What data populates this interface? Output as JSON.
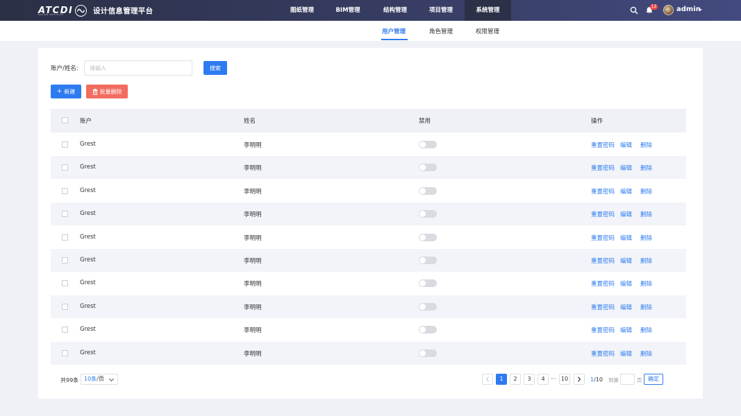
{
  "app": {
    "logo_text": "ATCDI",
    "logo_subtext": "DESIGN INSTITUTE",
    "title": "设计信息管理平台"
  },
  "nav": {
    "items": [
      {
        "label": "图纸管理"
      },
      {
        "label": "BIM管理"
      },
      {
        "label": "结构管理"
      },
      {
        "label": "项目管理"
      },
      {
        "label": "系统管理",
        "active": true
      }
    ],
    "notification_count": "12",
    "user": "admin"
  },
  "subnav": {
    "tabs": [
      {
        "label": "用户管理",
        "active": true
      },
      {
        "label": "角色管理"
      },
      {
        "label": "权限管理"
      }
    ]
  },
  "filter": {
    "label": "账户/姓名:",
    "placeholder": "请输入",
    "value": "",
    "search_label": "搜索"
  },
  "actions": {
    "new_label": "新建",
    "batch_delete_label": "批量删除"
  },
  "table": {
    "headers": {
      "account": "账户",
      "name": "姓名",
      "disabled": "禁用",
      "actions": "操作"
    },
    "ops": {
      "reset": "重置密码",
      "edit": "编辑",
      "delete": "删除"
    },
    "rows": [
      {
        "account": "Grest",
        "name": "李明明",
        "disabled": false
      },
      {
        "account": "Grest",
        "name": "李明明",
        "disabled": false
      },
      {
        "account": "Grest",
        "name": "李明明",
        "disabled": false
      },
      {
        "account": "Grest",
        "name": "李明明",
        "disabled": false
      },
      {
        "account": "Grest",
        "name": "李明明",
        "disabled": false
      },
      {
        "account": "Grest",
        "name": "李明明",
        "disabled": false
      },
      {
        "account": "Grest",
        "name": "李明明",
        "disabled": false
      },
      {
        "account": "Grest",
        "name": "李明明",
        "disabled": false
      },
      {
        "account": "Grest",
        "name": "李明明",
        "disabled": false
      },
      {
        "account": "Grest",
        "name": "李明明",
        "disabled": false
      }
    ]
  },
  "pagination": {
    "total": "共99条",
    "page_size": "10条",
    "page_size_suffix": "/页",
    "pages": [
      "1",
      "2",
      "3",
      "4",
      "10"
    ],
    "ellipsis": "···",
    "current_page": "1",
    "total_pages": "/10",
    "goto_label": "到第",
    "goto_unit": "页",
    "confirm_label": "确定"
  },
  "colors": {
    "accent": "#2d7bf0",
    "danger": "#f26c5f",
    "topbar": "#373d63"
  }
}
